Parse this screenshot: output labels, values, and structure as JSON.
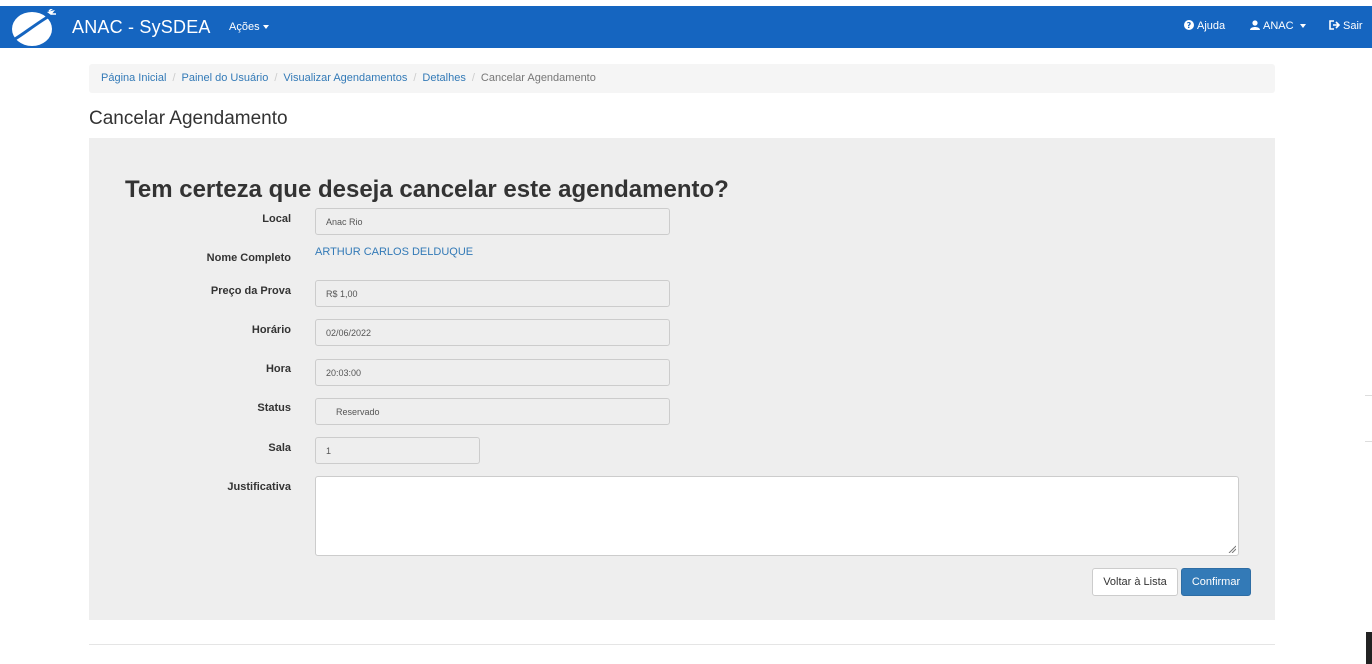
{
  "header": {
    "title": "ANAC - SySDEA",
    "acoes": "Ações",
    "ajuda": "Ajuda",
    "user": "ANAC",
    "sair": "Sair"
  },
  "breadcrumb": {
    "items": [
      "Página Inicial",
      "Painel do Usuário",
      "Visualizar Agendamentos",
      "Detalhes"
    ],
    "active": "Cancelar Agendamento"
  },
  "page": {
    "title": "Cancelar Agendamento",
    "question": "Tem certeza que deseja cancelar este agendamento?"
  },
  "form": {
    "local": {
      "label": "Local",
      "value": "Anac Rio"
    },
    "nome": {
      "label": "Nome Completo",
      "value": "ARTHUR CARLOS DELDUQUE"
    },
    "preco": {
      "label": "Preço da Prova",
      "value": "R$ 1,00"
    },
    "horario": {
      "label": "Horário",
      "value": "02/06/2022"
    },
    "hora": {
      "label": "Hora",
      "value": "20:03:00"
    },
    "status": {
      "label": "Status",
      "value": "Reservado"
    },
    "sala": {
      "label": "Sala",
      "value": "1"
    },
    "justificativa": {
      "label": "Justificativa",
      "value": ""
    }
  },
  "buttons": {
    "voltar": "Voltar à Lista",
    "confirmar": "Confirmar"
  },
  "colors": {
    "navbar": "#1565c0",
    "primary": "#337ab7",
    "panel": "#eeeeee"
  }
}
